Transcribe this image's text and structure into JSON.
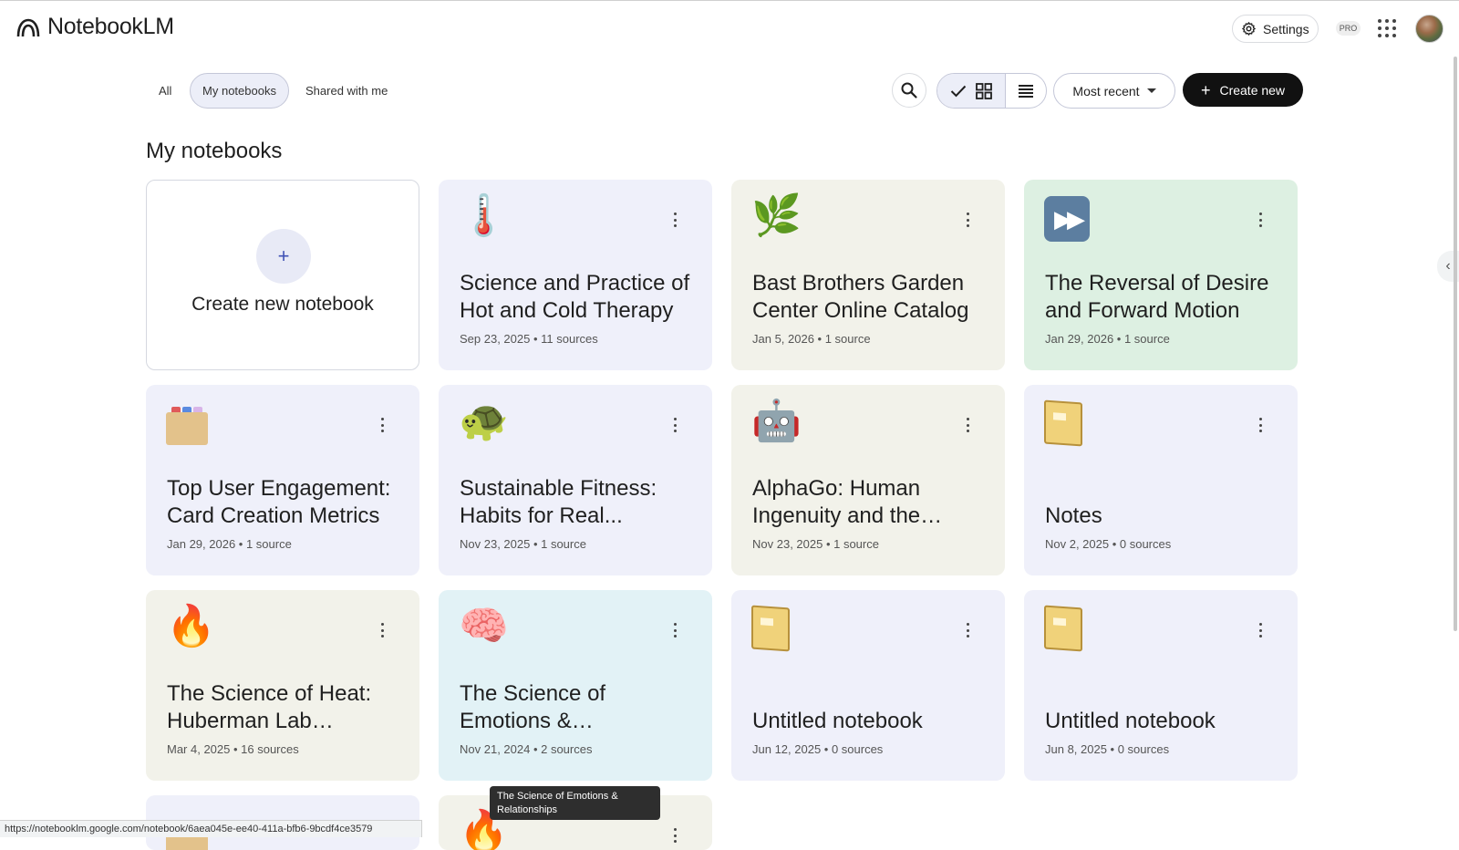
{
  "app": {
    "name": "NotebookLM"
  },
  "header": {
    "settings_label": "Settings",
    "pro_badge": "PRO"
  },
  "tabs": [
    {
      "label": "All",
      "active": false
    },
    {
      "label": "My notebooks",
      "active": true
    },
    {
      "label": "Shared with me",
      "active": false
    }
  ],
  "toolbar": {
    "sort_label": "Most recent",
    "create_label": "Create new",
    "view_mode": "grid"
  },
  "section_title": "My notebooks",
  "create_card": {
    "label": "Create new notebook",
    "plus": "+"
  },
  "notebooks": [
    {
      "emoji": "🌡️",
      "title": "Science and Practice of Hot and Cold Therapy",
      "meta": "Sep 23, 2025 • 11 sources",
      "color": "#eff0fa"
    },
    {
      "emoji": "🌿",
      "title": "Bast Brothers Garden Center Online Catalog",
      "meta": "Jan 5, 2026 • 1 source",
      "color": "#f2f2ea"
    },
    {
      "emoji": "⏩",
      "title": "The Reversal of Desire and Forward Motion",
      "meta": "Jan 29, 2026 • 1 source",
      "color": "#ddf0e2"
    },
    {
      "emoji": "🗂️",
      "title": "Top User Engagement: Card Creation Metrics",
      "meta": "Jan 29, 2026 • 1 source",
      "color": "#eff0fa"
    },
    {
      "emoji": "🐢",
      "title": "Sustainable Fitness: Habits for Real...",
      "meta": "Nov 23, 2025 • 1 source",
      "color": "#eff0fa"
    },
    {
      "emoji": "🤖",
      "title": "AlphaGo: Human Ingenuity and the Gam...",
      "meta": "Nov 23, 2025 • 1 source",
      "color": "#f2f2ea"
    },
    {
      "emoji": "📒",
      "title": "Notes",
      "meta": "Nov 2, 2025 • 0 sources",
      "color": "#eff0fa"
    },
    {
      "emoji": "🔥",
      "title": "The Science of Heat: Huberman Lab Podcas...",
      "meta": "Mar 4, 2025 • 16 sources",
      "color": "#f2f2ea"
    },
    {
      "emoji": "🧠",
      "title": "The Science of Emotions & Relationships",
      "meta": "Nov 21, 2024 • 2 sources",
      "color": "#e2f2f6"
    },
    {
      "emoji": "📒",
      "title": "Untitled notebook",
      "meta": "Jun 12, 2025 • 0 sources",
      "color": "#eff0fa"
    },
    {
      "emoji": "📒",
      "title": "Untitled notebook",
      "meta": "Jun 8, 2025 • 0 sources",
      "color": "#eff0fa"
    }
  ],
  "tooltip": "The Science of Emotions & Relationships",
  "status_url": "https://notebooklm.google.com/notebook/6aea045e-ee40-411a-bfb6-9bcdf4ce3579"
}
